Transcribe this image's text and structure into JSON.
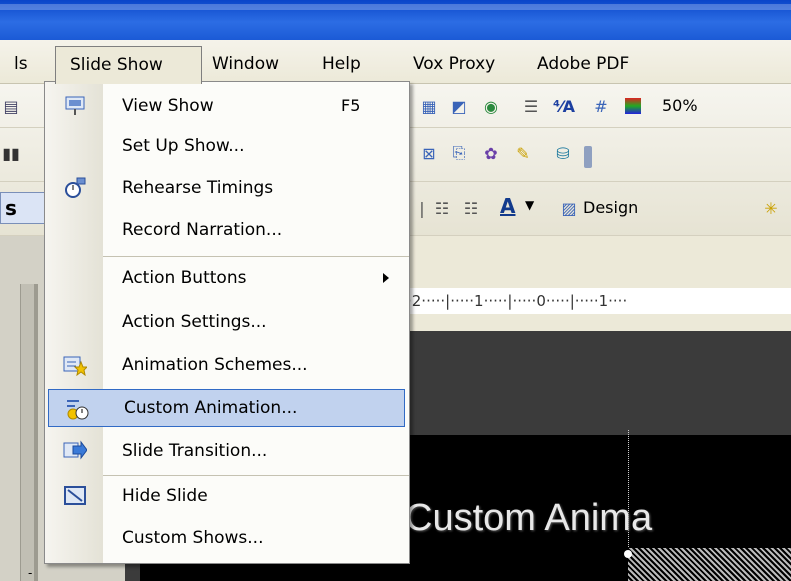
{
  "menubar": {
    "items": [
      {
        "label": "ls"
      },
      {
        "label": "Slide Show"
      },
      {
        "label": "Window"
      },
      {
        "label": "Help"
      },
      {
        "label": "Vox Proxy"
      },
      {
        "label": "Adobe PDF"
      }
    ]
  },
  "toolbar": {
    "zoom": "50%",
    "design_label": "Design",
    "font_color_glyph": "A",
    "panel_tab": "s"
  },
  "ruler": {
    "text": "·2·····|·····1·····|·····0·····|·····1····"
  },
  "slide": {
    "title": "Custom Anima"
  },
  "dropdown": {
    "items": [
      {
        "label": "View Show",
        "shortcut": "F5",
        "icon": "projector-screen-icon"
      },
      {
        "label": "Set Up Show...",
        "icon": ""
      },
      {
        "label": "Rehearse Timings",
        "icon": "stopwatch-icon"
      },
      {
        "label": "Record Narration...",
        "icon": ""
      },
      {
        "label": "Action Buttons",
        "icon": "",
        "submenu": true
      },
      {
        "label": "Action Settings...",
        "icon": ""
      },
      {
        "label": "Animation Schemes...",
        "icon": "animation-schemes-icon"
      },
      {
        "label": "Custom Animation...",
        "icon": "custom-animation-icon",
        "highlighted": true
      },
      {
        "label": "Slide Transition...",
        "icon": "slide-transition-icon"
      },
      {
        "label": "Hide Slide",
        "icon": "hide-slide-icon"
      },
      {
        "label": "Custom Shows...",
        "icon": ""
      }
    ]
  },
  "colors": {
    "titlebar": "#1b5ad6",
    "highlight": "#c1d2ee",
    "highlight_border": "#316ac5"
  }
}
